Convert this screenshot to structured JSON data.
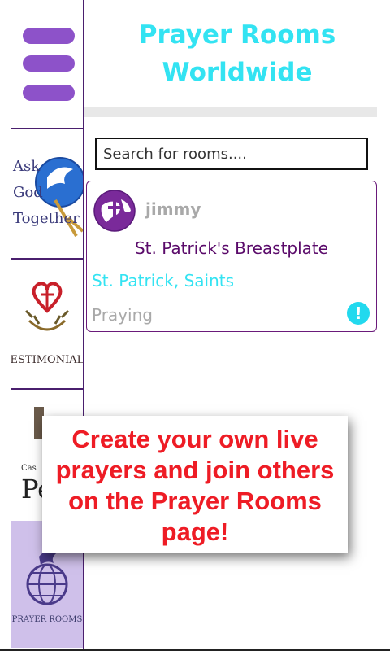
{
  "header": {
    "title_line1": "Prayer Rooms",
    "title_line2": "Worldwide"
  },
  "sidebar": {
    "menu_icon": "hamburger-menu-icon",
    "items": [
      {
        "name": "ask-god-together",
        "label": "Ask God Together",
        "icon": "dove-globe-icon"
      },
      {
        "name": "testimonials",
        "label": "TESTIMONIALS",
        "icon": "heart-cross-wreath-icon"
      },
      {
        "name": "personal",
        "label_top": "Cas",
        "label": "Pe",
        "icon": "book-icon"
      },
      {
        "name": "prayer-rooms",
        "label": "PRAYER ROOMS",
        "icon": "globe-dove-icon",
        "active": true
      }
    ]
  },
  "search": {
    "placeholder": "Search for rooms...."
  },
  "rooms": [
    {
      "user": "jimmy",
      "title": "St. Patrick's Breastplate",
      "tags": "St. Patrick, Saints",
      "status": "Praying",
      "alert_icon": "!"
    }
  ],
  "overlay": {
    "text": "Create your own live prayers and join others on the Prayer Rooms page!"
  },
  "colors": {
    "accent_cyan": "#33e3f2",
    "menu_purple": "#8d52c9",
    "border_purple": "#4a1f6e",
    "room_title": "#5a0a6a",
    "overlay_red": "#ee1c25"
  }
}
